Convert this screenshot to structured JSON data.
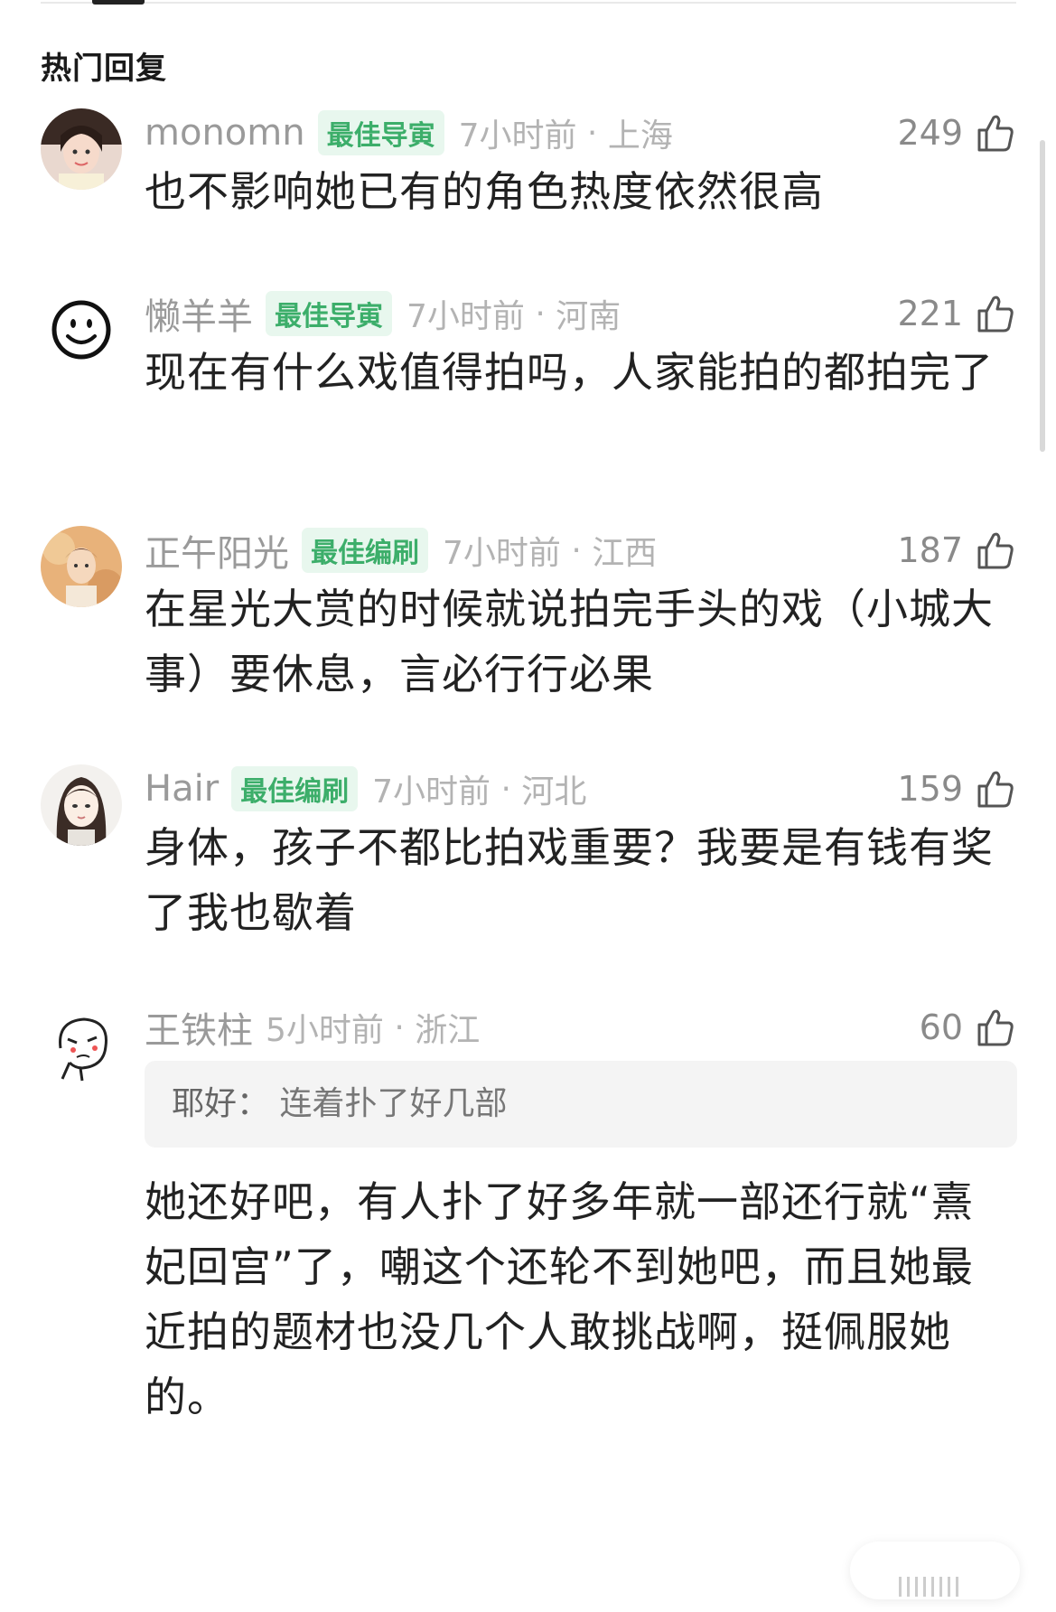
{
  "section_title": "热门回复",
  "colors": {
    "badge_text": "#3cae6a",
    "badge_bg": "#e8f7ee",
    "meta": "#b3b3b3"
  },
  "comments": [
    {
      "username": "monomn",
      "badge": "最佳导寅",
      "time": "7小时前",
      "location": "上海",
      "likes": "249",
      "text": "也不影响她已有的角色热度依然很高",
      "avatar": "woman-photo-avatar",
      "thumb_icon": "thumbs-up-icon"
    },
    {
      "username": "懒羊羊",
      "badge": "最佳导寅",
      "time": "7小时前",
      "location": "河南",
      "likes": "221",
      "text": "现在有什么戏值得拍吗，人家能拍的都拍完了",
      "avatar": "smiley-face-avatar",
      "thumb_icon": "thumbs-up-icon"
    },
    {
      "username": "正午阳光",
      "badge": "最佳编刷",
      "time": "7小时前",
      "location": "江西",
      "likes": "187",
      "text": "在星光大赏的时候就说拍完手头的戏（小城大事）要休息，言必行行必果",
      "avatar": "illustrated-portrait-avatar",
      "thumb_icon": "thumbs-up-icon"
    },
    {
      "username": "Hair",
      "badge": "最佳编刷",
      "time": "7小时前",
      "location": "河北",
      "likes": "159",
      "text": "身体，孩子不都比拍戏重要？我要是有钱有奖了我也歇着",
      "avatar": "cartoon-girl-avatar",
      "thumb_icon": "thumbs-up-icon"
    },
    {
      "username": "王铁柱",
      "badge": "",
      "time": "5小时前",
      "location": "浙江",
      "likes": "60",
      "quote_user": "耶好：",
      "quote_text": "连着扑了好几部",
      "text": "她还好吧，有人扑了好多年就一部还行就“熹妃回宫”了，嘲这个还轮不到她吧，而且她最近拍的题材也没几个人敢挑战啊，挺佩服她的。",
      "avatar": "doodle-face-avatar",
      "thumb_icon": "thumbs-up-icon"
    }
  ]
}
